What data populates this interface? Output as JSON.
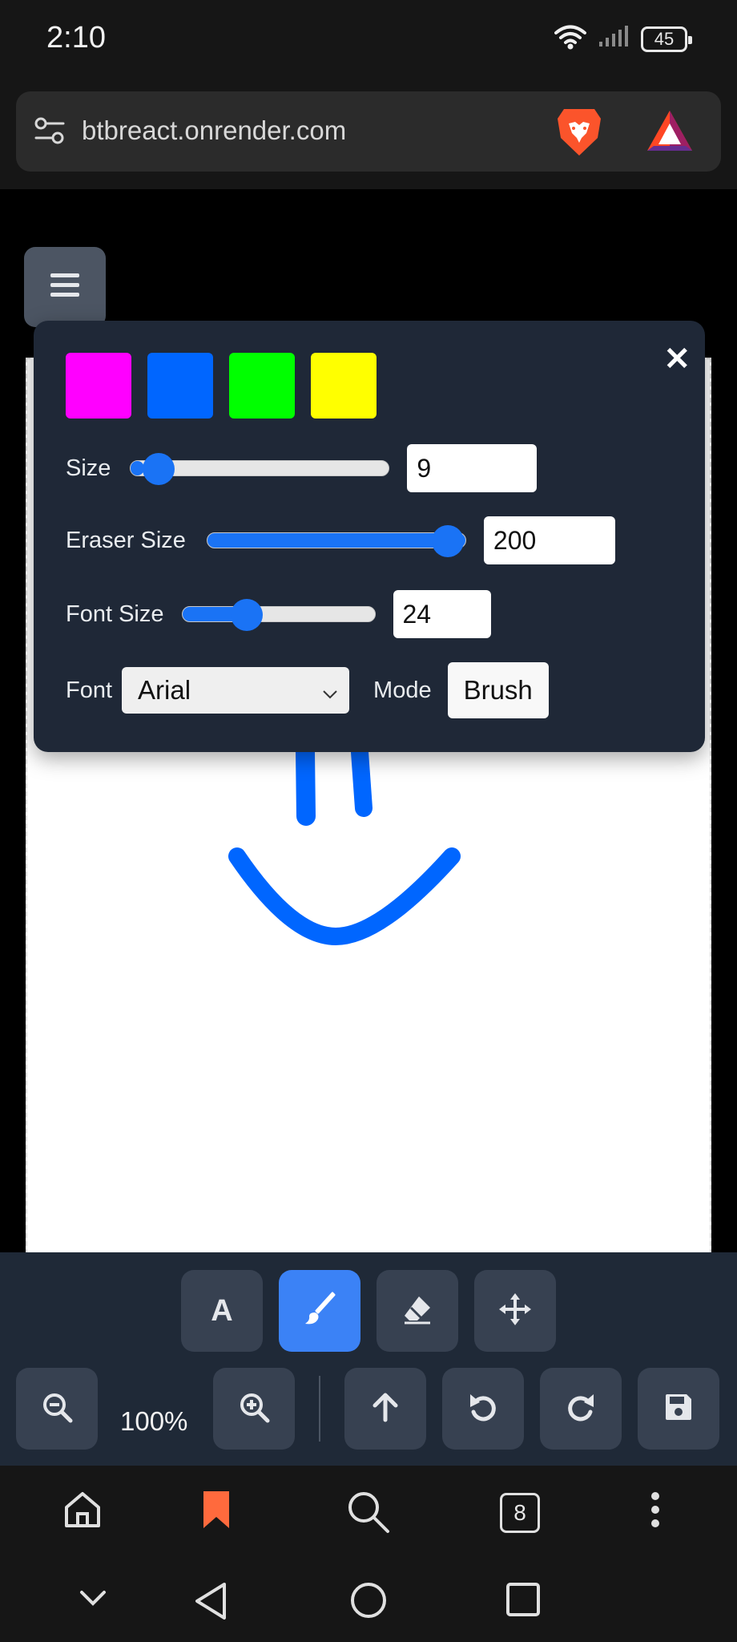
{
  "status": {
    "time": "2:10",
    "battery": "45"
  },
  "browser": {
    "url": "btbreact.onrender.com"
  },
  "panel": {
    "swatches": [
      "#ff00ff",
      "#0066ff",
      "#00ff00",
      "#ffff00"
    ],
    "size_label": "Size",
    "size_value": "9",
    "size_fraction": 0.05,
    "eraser_label": "Eraser Size",
    "eraser_value": "200",
    "eraser_fraction": 1.0,
    "font_size_label": "Font Size",
    "font_size_value": "24",
    "font_size_fraction": 0.3,
    "font_label": "Font",
    "font_value": "Arial",
    "mode_label": "Mode",
    "mode_value": "Brush",
    "accent": "#1a73f5"
  },
  "drawing": {
    "stroke_color": "#0066ff"
  },
  "toolbar": {
    "tools": [
      "text-tool",
      "brush-tool",
      "eraser-tool",
      "move-tool"
    ],
    "active_tool": "brush-tool",
    "text_tool_label": "A",
    "zoom_level": "100%",
    "active_color": "#3b82f6"
  },
  "bottomnav": {
    "tabs_count": "8",
    "bookmark_color": "#ff6a3d"
  }
}
